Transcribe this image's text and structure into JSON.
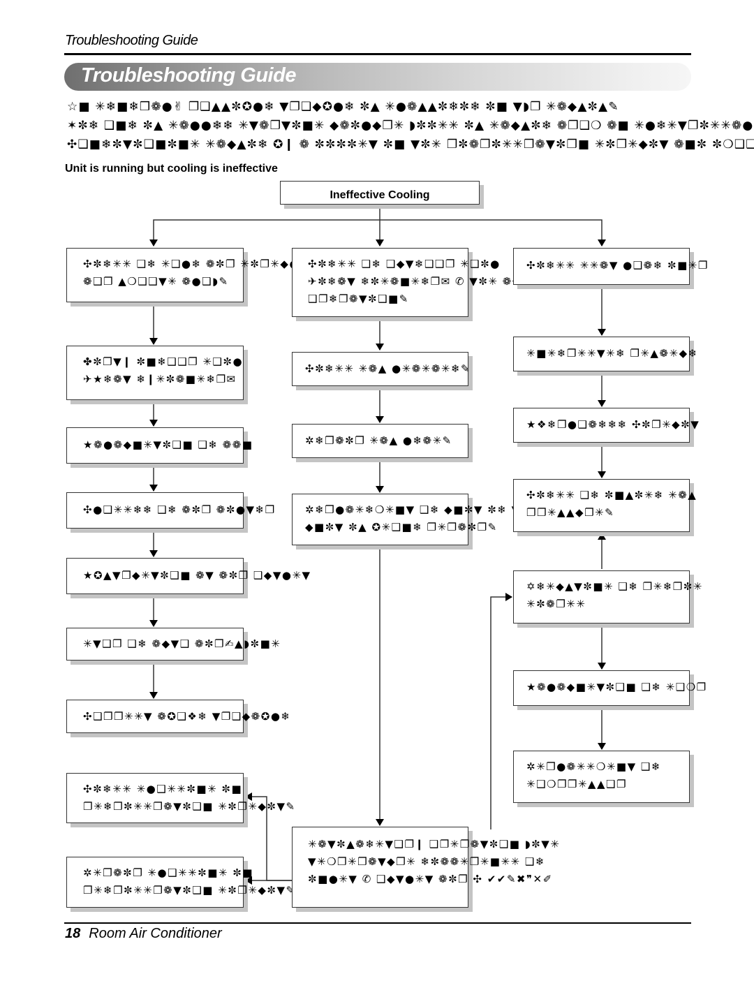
{
  "header": {
    "running_head": "Troubleshooting Guide",
    "banner_title": "Troubleshooting Guide"
  },
  "intro_lines": [
    "☆■ ✳❄■❄❒❁●✌ ❐❑▲▲✼✪●❄ ▼❐❑◆✪●❄ ✼▲ ✳●❁▲▲✼❄✼❄ ✼■ ▼◗❐ ✳❁◆▲✼▲✎",
    "✶✼❄ ❑■❄ ✼▲ ✳❁●●❄❄ ✳▼❁❐▼✼■✳ ◆❁✼●◆❐✳ ◗✼✼✳✳ ✼▲ ✳❁◆▲✼❄ ❁❐❑❍ ❁■ ✳●❄✳▼❐✼✳✳❁● ✼❁✼✳▼✌",
    "✣❑■❄✼▼✼❑■✼■✳ ✳❁◆▲✼❄ ✪❙ ❁ ✼✼✼✼✳▼ ✼■ ▼✼✳ ❐✼❁❐✼✳✳❐❁▼✼❐■ ✳✼❐✳◆✼▼ ❁■✼ ✼❍❑❑❑❑✼❑ ❁❑❑●✼✳❁▼"
  ],
  "section_heading": "Unit is running but cooling is ineffective",
  "flowchart": {
    "root": "Ineffective Cooling",
    "left_column": [
      [
        "✣✼❄✳✳ ❑❄ ✳❑●❄  ❁✼❐ ✳✼❐✳◆●❁▼✼✉■✳✳✳ ❑❄",
        "❁❑❐ ▲❍❑❑▼✳ ❁●❑◗✎"
      ],
      [
        "✤✼❐▼❙ ✼■❄❑❑❐ ✳❑✼●",
        "✈★❄❁▼ ❄❙✳✼❁■✳❄❐✉"
      ],
      [
        "★❁●❁◆■✳▼✼❑■ ❑❄ ❁❁■"
      ],
      [
        "✣●❑✳✳❄❄ ❑❄ ❁✼❐ ❁✼●▼❄❐"
      ],
      [
        "★✪▲▼❐◆✳▼✼❑■ ❁▼ ❁✼❐ ❑◆▼●✳▼"
      ],
      [
        "✳▼❑❐ ❑❄ ❁◆▼❑ ❁✼❐✍▲◗✼■✳"
      ],
      [
        "✣❑❐❐✳✳▼ ❁✪❑❖❄ ▼❐❑◆❁✪●❄"
      ],
      [
        "✣✼❄✳✳ ✳●❑✳✳✼■✳ ✼■",
        "❐✳❄❐✼✳✳❐❁▼✼❑■ ✳✼❐✳◆✼▼✎"
      ],
      [
        "✲✳❐❁✼❐ ✳●❑✳✳✼■✳ ✼■",
        "❐✳❄❐✼✳✳❐❁▼✼❑■ ✳✼❐✳◆✼▼✎"
      ]
    ],
    "middle_column": [
      [
        "✣✼❄✳✳ ❑❄ ❑◆▼❄❑❑❐ ✳❑✼●",
        "✈✼❄❁▼ ❄✼✳❁■✳❄❐✉ ✆ ▼✼✳ ❁❁■",
        "❑❐❄❐❁▼✼❑■✎"
      ],
      [
        "✣✼❄✳✳ ✳❁▲ ●✳❁✳❁✳❄✎"
      ],
      [
        "✲❄❐❁✼❐ ✳❁▲ ●❄❁✳✎"
      ],
      [
        "✲❄❐●❁✳❄❍✳■▼ ❑❄ ◆■✼▼ ✼❄ ▼✼",
        "◆■✼▼ ✼▲ ✪✳❑■❄ ❐✳❐❁✼❐✎"
      ],
      [
        "✳❁▼✼▲❁❄✳▼❑❐❙ ❑❐✳❐❁▼✼❑■ ◗✼▼✳",
        "▼✳❍❐✳❐❁▼◆❐✳ ❄✼❁❁✳❐✳■✳✳ ❑❄",
        "✼■●✳▼ ✆ ❑◆▼●✳▼ ❁✼❐ ✣ ✔✔✎✖❞✕✐"
      ]
    ],
    "right_column": [
      [
        "✣✼❄✳✳ ✳✳❁▼ ●❑❁❄ ✼■✳❐"
      ],
      [
        "✳■✳❄❐✳✳▼✳❄ ❐✳▲❁✳◆❄"
      ],
      [
        "★❖❄❐●❑❁❄❄❄ ✣✼❐✳◆✼▼"
      ],
      [
        "✣✼❄✳✳ ❑❄ ✼■▲✼✳❄ ✳❁▲",
        "❐❐✳▲▲◆❐✳✎"
      ],
      [
        "✡❄✳◆▲▼✼■✳ ❑❄ ❐✳❄❐✼✳",
        "✳✼❁❐✳✳"
      ],
      [
        "★❁●❁◆■✳▼✼❑■ ❑❄ ✳❑❍❐"
      ],
      [
        "✲✳❐●❁✳✳❍✳■▼ ❑❄",
        "✳❑❍❐❐✳▲▲❑❐"
      ]
    ]
  },
  "footer": {
    "page_number": "18",
    "title": "Room Air Conditioner"
  }
}
